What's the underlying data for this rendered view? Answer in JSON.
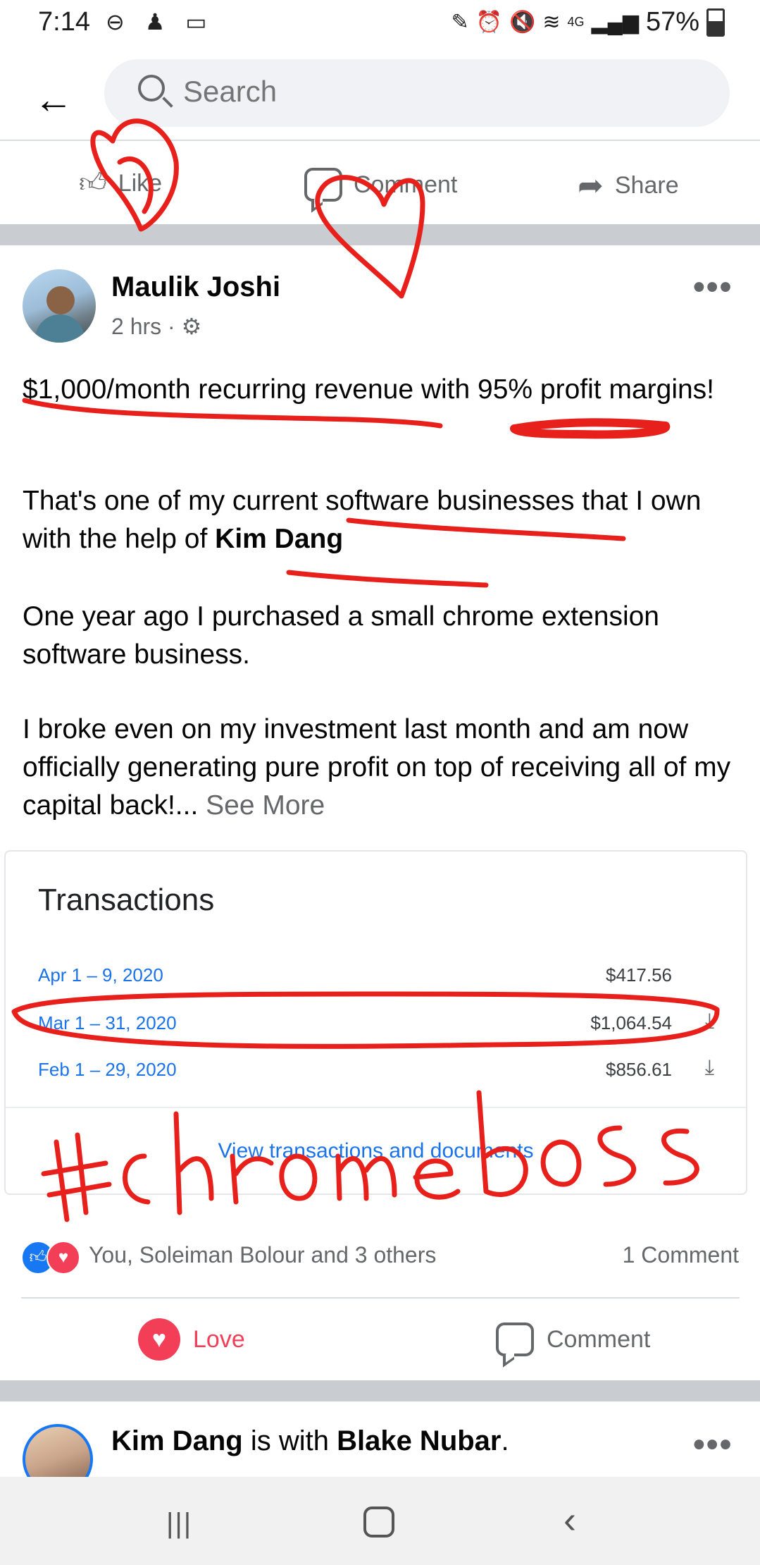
{
  "status_bar": {
    "time": "7:14",
    "left_icons": [
      "do-not-disturb-icon",
      "notification-icon",
      "clipboard-icon"
    ],
    "right_icons": [
      "nfc-icon",
      "alarm-icon",
      "mute-icon",
      "wifi-icon",
      "4g-icon",
      "signal-icon"
    ],
    "network": "4G",
    "battery": "57%"
  },
  "header": {
    "search_placeholder": "Search"
  },
  "prev_post_actions": {
    "like": "Like",
    "comment": "Comment",
    "share": "Share"
  },
  "post": {
    "author": "Maulik Joshi",
    "time": "2 hrs",
    "visibility_icon": "gear-icon",
    "more": "•••",
    "line1": "$1,000/month recurring revenue with 95% profit margins!",
    "p2_a": "That's one of my current software businesses that I own with the help of ",
    "p2_b": "Kim Dang",
    "p3": "One year ago I purchased a small chrome extension software business.",
    "p4": "I broke even on my investment last month and am now officially generating pure profit on top of receiving all of my capital back!...",
    "see_more": "See More"
  },
  "transactions": {
    "title": "Transactions",
    "rows": [
      {
        "date": "Apr 1 – 9, 2020",
        "amount": "$417.56",
        "download": false
      },
      {
        "date": "Mar 1 – 31, 2020",
        "amount": "$1,064.54",
        "download": true
      },
      {
        "date": "Feb 1 – 29, 2020",
        "amount": "$856.61",
        "download": true
      }
    ],
    "link": "View transactions and documents"
  },
  "annotation_text": "#chromeboss",
  "reactions": {
    "text": "You, Soleiman Bolour and 3 others",
    "comments": "1 Comment"
  },
  "post_actions": {
    "love": "Love",
    "comment": "Comment"
  },
  "next_post": {
    "author": "Kim Dang",
    "is_with": "is with",
    "with_name": "Blake Nubar",
    "more": "•••"
  },
  "colors": {
    "accent": "#1877f2",
    "love": "#f33e58",
    "annotation": "#e8201c",
    "secondary_text": "#65676b"
  }
}
